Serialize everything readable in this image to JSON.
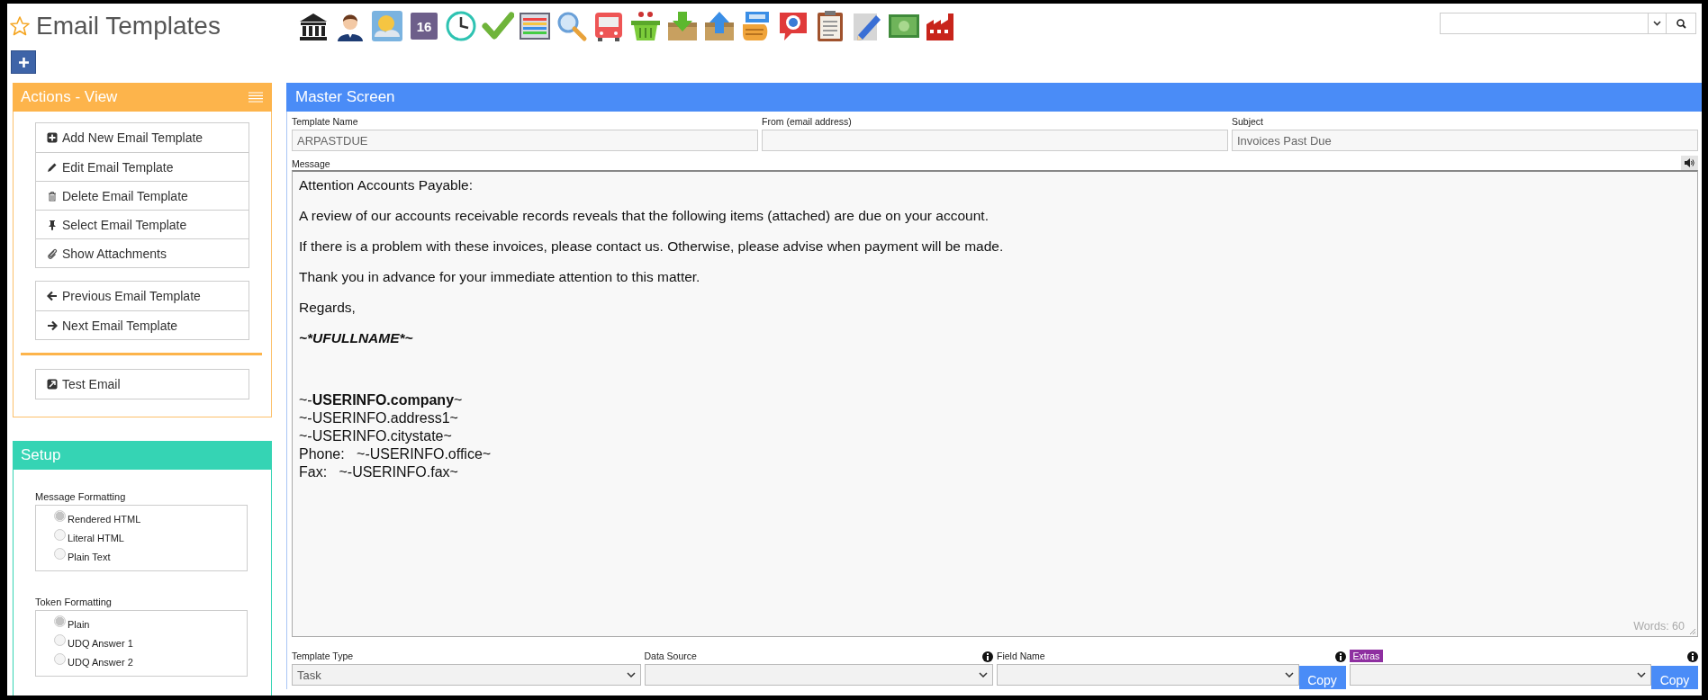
{
  "header": {
    "title": "Email Templates",
    "favorite": false,
    "toolbar": [
      {
        "kind": "bank"
      },
      {
        "kind": "person"
      },
      {
        "kind": "weather"
      },
      {
        "kind": "calendar",
        "label": "16"
      },
      {
        "kind": "clock"
      },
      {
        "kind": "check"
      },
      {
        "kind": "chart-window"
      },
      {
        "kind": "magnifier"
      },
      {
        "kind": "bus"
      },
      {
        "kind": "basket"
      },
      {
        "kind": "inbox-down"
      },
      {
        "kind": "inbox-up"
      },
      {
        "kind": "hand-card"
      },
      {
        "kind": "speech-dollar"
      },
      {
        "kind": "clipboard"
      },
      {
        "kind": "pencil-paper"
      },
      {
        "kind": "banknote"
      },
      {
        "kind": "factory"
      }
    ]
  },
  "actions_panel": {
    "title": "Actions - View",
    "groups": [
      [
        {
          "kind": "add",
          "label": "Add New Email Template"
        },
        {
          "kind": "edit",
          "label": "Edit Email Template"
        },
        {
          "kind": "delete",
          "label": "Delete Email Template"
        },
        {
          "kind": "pin",
          "label": "Select Email Template"
        },
        {
          "kind": "attach",
          "label": "Show Attachments"
        }
      ],
      [
        {
          "kind": "prev",
          "label": "Previous Email Template"
        },
        {
          "kind": "next",
          "label": "Next Email Template"
        }
      ],
      [
        {
          "kind": "external",
          "label": "Test Email"
        }
      ]
    ]
  },
  "setup_panel": {
    "title": "Setup",
    "groups": [
      {
        "label": "Message Formatting",
        "options": [
          {
            "label": "Rendered HTML",
            "selected": true
          },
          {
            "label": "Literal HTML",
            "selected": false
          },
          {
            "label": "Plain Text",
            "selected": false
          }
        ]
      },
      {
        "label": "Token Formatting",
        "options": [
          {
            "label": "Plain",
            "selected": true
          },
          {
            "label": "UDQ Answer 1",
            "selected": false
          },
          {
            "label": "UDQ Answer 2",
            "selected": false
          }
        ]
      }
    ]
  },
  "master": {
    "title": "Master Screen",
    "fields": [
      {
        "label": "Template Name",
        "value": "ARPASTDUE"
      },
      {
        "label": "From (email address)"
      },
      {
        "label": "Subject",
        "value": "Invoices Past Due"
      }
    ],
    "message": {
      "label": "Message",
      "word_count": "Words: 60",
      "lines": [
        {
          "kind": "para",
          "text": "Attention Accounts Payable:"
        },
        {
          "kind": "para",
          "text": "A review of our accounts receivable records reveals that the following items (attached) are due on your account."
        },
        {
          "kind": "para",
          "text": "If there is a problem with these invoices, please contact us. Otherwise, please advise when payment will be made."
        },
        {
          "kind": "para",
          "text": "Thank you in advance for your immediate attention to this matter."
        },
        {
          "kind": "para",
          "text": "Regards,"
        },
        {
          "kind": "signature",
          "text": "~*UFULLNAME*~"
        },
        {
          "kind": "address",
          "text": "~-**USERINFO.company**~"
        },
        {
          "kind": "address",
          "text": "~-USERINFO.address1~"
        },
        {
          "kind": "address",
          "text": "~-USERINFO.citystate~"
        },
        {
          "kind": "address",
          "text": "Phone:   ~-USERINFO.office~"
        },
        {
          "kind": "address",
          "text": "Fax:   ~-USERINFO.fax~"
        }
      ]
    },
    "selectors": [
      {
        "kind": "plain",
        "label": "Template Type",
        "value": "Task",
        "info": false
      },
      {
        "kind": "plain",
        "label": "Data Source",
        "info": true
      },
      {
        "kind": "plain",
        "label": "Field Name",
        "info": true,
        "button": "Copy"
      },
      {
        "kind": "badge",
        "label": "Extras",
        "info": true,
        "button": "Copy"
      }
    ]
  }
}
